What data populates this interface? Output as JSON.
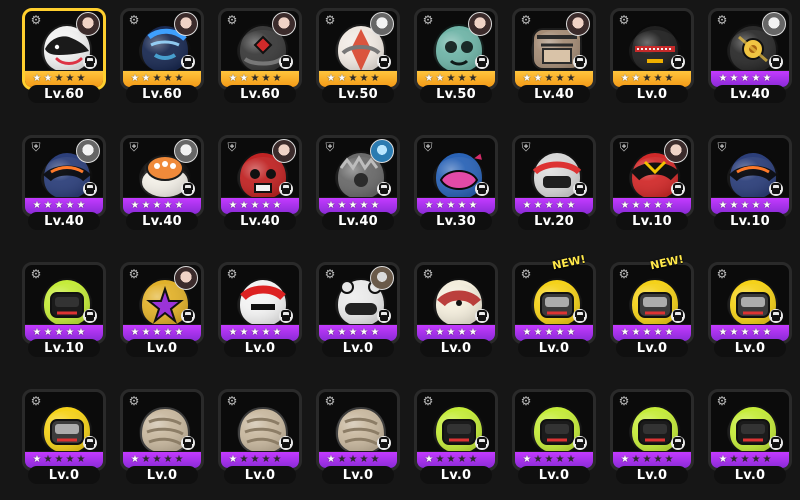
{
  "inventory": {
    "items": [
      {
        "level": "Lv.60",
        "rarity": "orange",
        "stars": 2,
        "selected": true,
        "has_avatar": true,
        "avatar_style": "ha",
        "type_icon": "gear-icon",
        "art": "white-orca-helmet",
        "new": false
      },
      {
        "level": "Lv.60",
        "rarity": "orange",
        "stars": 2,
        "selected": false,
        "has_avatar": true,
        "avatar_style": "ha",
        "type_icon": "gear-icon",
        "art": "blue-armored-helmet",
        "new": false
      },
      {
        "level": "Lv.60",
        "rarity": "orange",
        "stars": 2,
        "selected": false,
        "has_avatar": true,
        "avatar_style": "ha",
        "type_icon": "gear-icon",
        "art": "dark-helmet-red-core",
        "new": false
      },
      {
        "level": "Lv.50",
        "rarity": "orange",
        "stars": 2,
        "selected": false,
        "has_avatar": true,
        "avatar_style": "hb",
        "type_icon": "gear-icon",
        "art": "white-red-helmet",
        "new": false
      },
      {
        "level": "Lv.50",
        "rarity": "orange",
        "stars": 2,
        "selected": false,
        "has_avatar": true,
        "avatar_style": "ha",
        "type_icon": "gear-icon",
        "art": "teal-skull-helmet",
        "new": false
      },
      {
        "level": "Lv.40",
        "rarity": "orange",
        "stars": 2,
        "selected": false,
        "has_avatar": true,
        "avatar_style": "ha",
        "type_icon": "gear-icon",
        "art": "temple-helmet",
        "new": false
      },
      {
        "level": "Lv.0",
        "rarity": "orange",
        "stars": 2,
        "selected": false,
        "has_avatar": false,
        "avatar_style": "",
        "type_icon": "gear-icon",
        "art": "black-red-zipper-helmet",
        "new": false
      },
      {
        "level": "Lv.40",
        "rarity": "purple",
        "stars": 5,
        "selected": false,
        "has_avatar": true,
        "avatar_style": "hb",
        "type_icon": "gear-icon",
        "art": "gold-ring-helmet",
        "new": false
      },
      {
        "level": "Lv.40",
        "rarity": "purple",
        "stars": 5,
        "selected": false,
        "has_avatar": true,
        "avatar_style": "hb",
        "type_icon": "shield-icon",
        "art": "blue-black-helmet",
        "new": false
      },
      {
        "level": "Lv.40",
        "rarity": "purple",
        "stars": 5,
        "selected": false,
        "has_avatar": true,
        "avatar_style": "hb",
        "type_icon": "shield-icon",
        "art": "food-bowl-helmet",
        "new": false
      },
      {
        "level": "Lv.40",
        "rarity": "purple",
        "stars": 5,
        "selected": false,
        "has_avatar": true,
        "avatar_style": "ha",
        "type_icon": "shield-icon",
        "art": "red-skull-helmet",
        "new": false
      },
      {
        "level": "Lv.40",
        "rarity": "purple",
        "stars": 5,
        "selected": false,
        "has_avatar": true,
        "avatar_style": "hc",
        "type_icon": "shield-icon",
        "art": "gray-spiky-helmet",
        "new": false
      },
      {
        "level": "Lv.30",
        "rarity": "purple",
        "stars": 5,
        "selected": false,
        "has_avatar": false,
        "avatar_style": "",
        "type_icon": "shield-icon",
        "art": "lips-helmet",
        "new": false
      },
      {
        "level": "Lv.20",
        "rarity": "purple",
        "stars": 5,
        "selected": false,
        "has_avatar": false,
        "avatar_style": "",
        "type_icon": "shield-icon",
        "art": "orange-black-helmet",
        "new": false
      },
      {
        "level": "Lv.10",
        "rarity": "purple",
        "stars": 5,
        "selected": false,
        "has_avatar": true,
        "avatar_style": "ha",
        "type_icon": "shield-icon",
        "art": "red-black-visor-helmet",
        "new": false
      },
      {
        "level": "Lv.10",
        "rarity": "purple",
        "stars": 5,
        "selected": false,
        "has_avatar": false,
        "avatar_style": "",
        "type_icon": "shield-icon",
        "art": "blue-black-helmet-2",
        "new": false
      },
      {
        "level": "Lv.10",
        "rarity": "purple",
        "stars": 5,
        "selected": false,
        "has_avatar": false,
        "avatar_style": "",
        "type_icon": "gear-icon",
        "art": "green-welder-helmet",
        "new": false
      },
      {
        "level": "Lv.0",
        "rarity": "purple",
        "stars": 5,
        "selected": false,
        "has_avatar": true,
        "avatar_style": "ha",
        "type_icon": "gear-icon",
        "art": "purple-yellow-star-helmet",
        "new": false
      },
      {
        "level": "Lv.0",
        "rarity": "purple",
        "stars": 5,
        "selected": false,
        "has_avatar": false,
        "avatar_style": "",
        "type_icon": "gear-icon",
        "art": "red-white-helmet",
        "new": false
      },
      {
        "level": "Lv.0",
        "rarity": "purple",
        "stars": 5,
        "selected": false,
        "has_avatar": true,
        "avatar_style": "hd",
        "type_icon": "gear-icon",
        "art": "white-bear-helmet",
        "new": false
      },
      {
        "level": "Lv.0",
        "rarity": "purple",
        "stars": 5,
        "selected": false,
        "has_avatar": false,
        "avatar_style": "",
        "type_icon": "gear-icon",
        "art": "cream-red-helmet",
        "new": false
      },
      {
        "level": "Lv.0",
        "rarity": "purple",
        "stars": 5,
        "selected": false,
        "has_avatar": false,
        "avatar_style": "",
        "type_icon": "gear-icon",
        "art": "yellow-welder-helmet",
        "new": true
      },
      {
        "level": "Lv.0",
        "rarity": "purple",
        "stars": 5,
        "selected": false,
        "has_avatar": false,
        "avatar_style": "",
        "type_icon": "gear-icon",
        "art": "yellow-welder-helmet",
        "new": true
      },
      {
        "level": "Lv.0",
        "rarity": "purple",
        "stars": 5,
        "selected": false,
        "has_avatar": false,
        "avatar_style": "",
        "type_icon": "gear-icon",
        "art": "yellow-welder-helmet",
        "new": false
      },
      {
        "level": "Lv.0",
        "rarity": "purple",
        "stars": 1,
        "selected": false,
        "has_avatar": false,
        "avatar_style": "",
        "type_icon": "gear-icon",
        "art": "yellow-welder-helmet",
        "new": false
      },
      {
        "level": "Lv.0",
        "rarity": "purple",
        "stars": 1,
        "selected": false,
        "has_avatar": false,
        "avatar_style": "",
        "type_icon": "gear-icon",
        "art": "stone-helmet",
        "new": false
      },
      {
        "level": "Lv.0",
        "rarity": "purple",
        "stars": 1,
        "selected": false,
        "has_avatar": false,
        "avatar_style": "",
        "type_icon": "gear-icon",
        "art": "stone-helmet",
        "new": false
      },
      {
        "level": "Lv.0",
        "rarity": "purple",
        "stars": 1,
        "selected": false,
        "has_avatar": false,
        "avatar_style": "",
        "type_icon": "gear-icon",
        "art": "stone-helmet",
        "new": false
      },
      {
        "level": "Lv.0",
        "rarity": "purple",
        "stars": 1,
        "selected": false,
        "has_avatar": false,
        "avatar_style": "",
        "type_icon": "gear-icon",
        "art": "green-welder-helmet",
        "new": false
      },
      {
        "level": "Lv.0",
        "rarity": "purple",
        "stars": 1,
        "selected": false,
        "has_avatar": false,
        "avatar_style": "",
        "type_icon": "gear-icon",
        "art": "green-welder-helmet",
        "new": false
      },
      {
        "level": "Lv.0",
        "rarity": "purple",
        "stars": 1,
        "selected": false,
        "has_avatar": false,
        "avatar_style": "",
        "type_icon": "gear-icon",
        "art": "green-welder-helmet",
        "new": false
      },
      {
        "level": "Lv.0",
        "rarity": "purple",
        "stars": 1,
        "selected": false,
        "has_avatar": false,
        "avatar_style": "",
        "type_icon": "gear-icon",
        "art": "green-welder-helmet",
        "new": false
      }
    ],
    "new_badge_text": "NEW!"
  },
  "colors": {
    "background": "#161616",
    "selected_border": "#ffcf2e",
    "rarity_orange": "#f39a17",
    "rarity_purple": "#8a2bd6"
  }
}
